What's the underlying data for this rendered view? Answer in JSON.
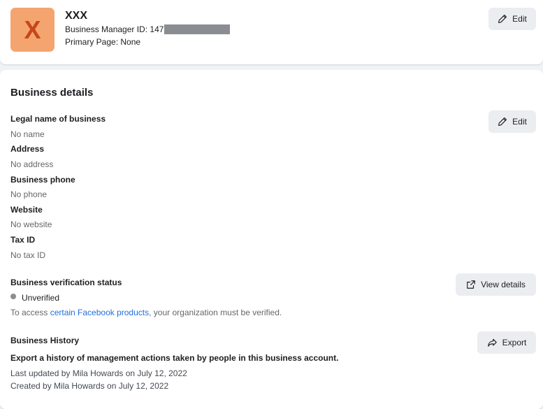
{
  "header": {
    "avatar_letter": "X",
    "business_name": "XXX",
    "manager_id_label": "Business Manager ID: 147",
    "primary_page": "Primary Page: None",
    "edit_label": "Edit"
  },
  "details": {
    "title": "Business details",
    "edit_label": "Edit",
    "fields": [
      {
        "label": "Legal name of business",
        "value": "No name"
      },
      {
        "label": "Address",
        "value": "No address"
      },
      {
        "label": "Business phone",
        "value": "No phone"
      },
      {
        "label": "Website",
        "value": "No website"
      },
      {
        "label": "Tax ID",
        "value": "No tax ID"
      }
    ]
  },
  "verification": {
    "label": "Business verification status",
    "status": "Unverified",
    "note_prefix": "To access ",
    "note_link": "certain Facebook products",
    "note_suffix": ", your organization must be verified.",
    "view_details_label": "View details"
  },
  "history": {
    "label": "Business History",
    "description": "Export a history of management actions taken by people in this business account.",
    "last_updated": "Last updated by Mila Howards on July 12, 2022",
    "created": "Created by Mila Howards on July 12, 2022",
    "export_label": "Export"
  },
  "colors": {
    "avatar_bg": "#f4a56f",
    "avatar_letter": "#c8461b",
    "link": "#216fdb",
    "button_bg": "#ebedf0",
    "status_dot": "#8a8d91"
  }
}
